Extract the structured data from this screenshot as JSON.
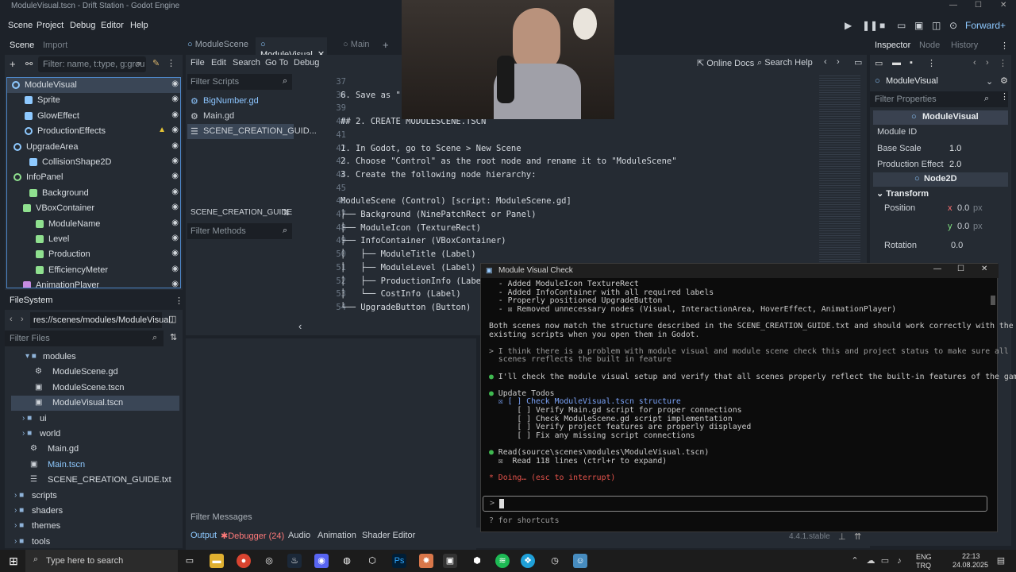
{
  "window_title": "ModuleVisual.tscn - Drift Station - Godot Engine",
  "menu": {
    "scene": "Scene",
    "project": "Project",
    "debug": "Debug",
    "editor": "Editor",
    "help": "Help",
    "renderer": "Forward+"
  },
  "scene_dock": {
    "tab_scene": "Scene",
    "tab_import": "Import",
    "filter_placeholder": "Filter: name, t:type, g:grou",
    "nodes": [
      {
        "label": "ModuleVisual"
      },
      {
        "label": "Sprite"
      },
      {
        "label": "GlowEffect"
      },
      {
        "label": "ProductionEffects"
      },
      {
        "label": "UpgradeArea"
      },
      {
        "label": "CollisionShape2D"
      },
      {
        "label": "InfoPanel"
      },
      {
        "label": "Background"
      },
      {
        "label": "VBoxContainer"
      },
      {
        "label": "ModuleName"
      },
      {
        "label": "Level"
      },
      {
        "label": "Production"
      },
      {
        "label": "EfficiencyMeter"
      },
      {
        "label": "AnimationPlayer"
      }
    ]
  },
  "filesystem": {
    "title": "FileSystem",
    "path": "res://scenes/modules/ModuleVisual.",
    "filter_placeholder": "Filter Files",
    "items": [
      {
        "label": "modules"
      },
      {
        "label": "ModuleScene.gd"
      },
      {
        "label": "ModuleScene.tscn"
      },
      {
        "label": "ModuleVisual.tscn"
      },
      {
        "label": "ui"
      },
      {
        "label": "world"
      },
      {
        "label": "Main.gd"
      },
      {
        "label": "Main.tscn"
      },
      {
        "label": "SCENE_CREATION_GUIDE.txt"
      },
      {
        "label": "scripts"
      },
      {
        "label": "shaders"
      },
      {
        "label": "themes"
      },
      {
        "label": "tools"
      }
    ]
  },
  "editor_tabs": [
    {
      "label": "ModuleScene"
    },
    {
      "label": "ModuleVisual"
    },
    {
      "label": "Main"
    }
  ],
  "script_menu": {
    "file": "File",
    "edit": "Edit",
    "search": "Search",
    "goto": "Go To",
    "debug": "Debug",
    "online_docs": "Online Docs",
    "search_help": "Search Help"
  },
  "scripts_panel": {
    "filter_placeholder": "Filter Scripts",
    "items": [
      {
        "label": "BigNumber.gd"
      },
      {
        "label": "Main.gd"
      },
      {
        "label": "SCENE_CREATION_GUID..."
      }
    ],
    "current": "SCENE_CREATION_GUIDE",
    "filter_methods": "Filter Methods"
  },
  "code_lines": [
    {
      "n": "37",
      "t": ""
    },
    {
      "n": "38",
      "t": "6. Save as \"re"
    },
    {
      "n": "39",
      "t": ""
    },
    {
      "n": "40",
      "t": "## 2. CREATE MODULESCENE.TSCN"
    },
    {
      "n": "41",
      "t": ""
    },
    {
      "n": "42",
      "t": "1. In Godot, go to Scene > New Scene"
    },
    {
      "n": "43",
      "t": "2. Choose \"Control\" as the root node and rename it to \"ModuleScene\""
    },
    {
      "n": "44",
      "t": "3. Create the following node hierarchy:"
    },
    {
      "n": "45",
      "t": ""
    },
    {
      "n": "46",
      "t": "ModuleScene (Control) [script: ModuleScene.gd]"
    },
    {
      "n": "47",
      "t": "├── Background (NinePatchRect or Panel)"
    },
    {
      "n": "48",
      "t": "├── ModuleIcon (TextureRect)"
    },
    {
      "n": "49",
      "t": "├── InfoContainer (VBoxContainer)"
    },
    {
      "n": "50",
      "t": "│   ├── ModuleTitle (Label)"
    },
    {
      "n": "51",
      "t": "│   ├── ModuleLevel (Label)"
    },
    {
      "n": "52",
      "t": "│   ├── ProductionInfo (Label)"
    },
    {
      "n": "53",
      "t": "│   └── CostInfo (Label)"
    },
    {
      "n": "54",
      "t": "└── UpgradeButton (Button)"
    }
  ],
  "bottom_panel": {
    "filter_messages": "Filter Messages",
    "tabs": [
      {
        "label": "Output"
      },
      {
        "label": "Debugger (24)"
      },
      {
        "label": "Audio"
      },
      {
        "label": "Animation"
      },
      {
        "label": "Shader Editor"
      }
    ],
    "version": "4.4.1.stable"
  },
  "terminal": {
    "title": "Module Visual Check",
    "lines": [
      {
        "t": "  - Added ModuleIcon TextureRect",
        "c": ""
      },
      {
        "t": "  - Added InfoContainer with all required labels",
        "c": ""
      },
      {
        "t": "  - Properly positioned UpgradeButton",
        "c": ""
      },
      {
        "t": "  - ☒ Removed unnecessary nodes (Visual, InteractionArea, HoverEffect, AnimationPlayer)",
        "c": ""
      },
      {
        "t": "",
        "c": ""
      },
      {
        "t": "Both scenes now match the structure described in the SCENE_CREATION_GUIDE.txt and should work correctly with the",
        "c": ""
      },
      {
        "t": "existing scripts when you open them in Godot.",
        "c": ""
      },
      {
        "t": "",
        "c": ""
      },
      {
        "t": "> I think there is a problem with module visual and module scene check this and project status to make sure all",
        "c": "grey"
      },
      {
        "t": "  scenes rreflects the built in feature",
        "c": "grey"
      },
      {
        "t": "",
        "c": ""
      },
      {
        "t": "● I'll check the module visual setup and verify that all scenes properly reflect the built-in features of the game.",
        "c": ""
      },
      {
        "t": "",
        "c": ""
      },
      {
        "t": "● Update Todos",
        "c": ""
      },
      {
        "t": "  ☒ [ ] Check ModuleVisual.tscn structure",
        "c": "blue"
      },
      {
        "t": "      [ ] Verify Main.gd script for proper connections",
        "c": ""
      },
      {
        "t": "      [ ] Check ModuleScene.gd script implementation",
        "c": ""
      },
      {
        "t": "      [ ] Verify project features are properly displayed",
        "c": ""
      },
      {
        "t": "      [ ] Fix any missing script connections",
        "c": ""
      },
      {
        "t": "",
        "c": ""
      },
      {
        "t": "● Read(source\\scenes\\modules\\ModuleVisual.tscn)",
        "c": ""
      },
      {
        "t": "  ☒  Read 118 lines (ctrl+r to expand)",
        "c": ""
      },
      {
        "t": "",
        "c": ""
      },
      {
        "t": "* Doing… (esc to interrupt)",
        "c": ""
      }
    ],
    "prompt": ">",
    "hint": "? for shortcuts"
  },
  "inspector": {
    "tab_inspector": "Inspector",
    "tab_node": "Node",
    "tab_history": "History",
    "object": "ModuleVisual",
    "filter_placeholder": "Filter Properties",
    "section": "ModuleVisual",
    "props": [
      {
        "k": "Module ID",
        "v": ""
      },
      {
        "k": "Base Scale",
        "v": "1.0"
      },
      {
        "k": "Production Effect",
        "v": "2.0"
      }
    ],
    "node2d": "Node2D",
    "transform": "Transform",
    "position": "Position",
    "pos_x": "0.0",
    "pos_y": "0.0",
    "unit": "px",
    "rotation": "Rotation",
    "rot_val": "0.0"
  },
  "taskbar": {
    "search_placeholder": "Type here to search",
    "lang1": "ENG",
    "lang2": "TRQ",
    "time": "22:13",
    "date": "24.08.2025"
  }
}
